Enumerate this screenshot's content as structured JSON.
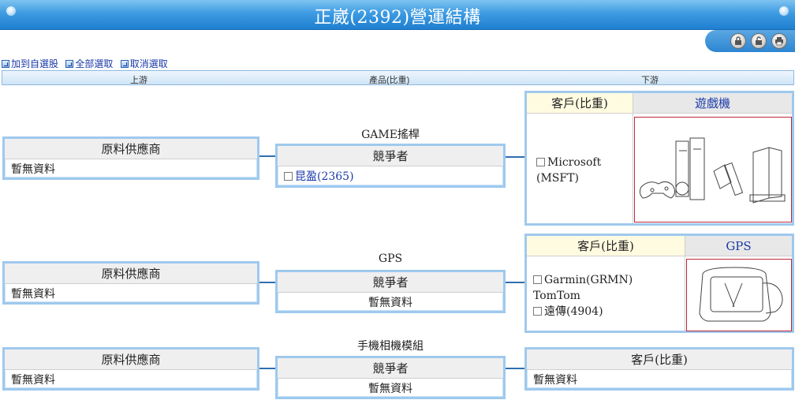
{
  "title": "正崴(2392)營運結構",
  "toolbar": {
    "icons": [
      "lock-icon",
      "unlock-icon",
      "print-icon"
    ]
  },
  "links": [
    "加到自選股",
    "全部選取",
    "取消選取"
  ],
  "columns": {
    "upstream": "上游",
    "product": "產品(比重)",
    "downstream": "下游"
  },
  "rows": [
    {
      "product_name": "GAME搖桿",
      "supplier_header": "原料供應商",
      "supplier_value": "暫無資料",
      "competitor_header": "競爭者",
      "competitors": [
        "昆盈(2365)"
      ],
      "customer_header": "客戶(比重)",
      "product_header": "遊戲機",
      "customers": [
        "Microsoft (MSFT)"
      ]
    },
    {
      "product_name": "GPS",
      "supplier_header": "原料供應商",
      "supplier_value": "暫無資料",
      "competitor_header": "競爭者",
      "competitor_value": "暫無資料",
      "customer_header": "客戶(比重)",
      "product_header": "GPS",
      "customers": [
        "Garmin(GRMN)",
        "TomTom",
        "遠傳(4904)"
      ]
    },
    {
      "product_name": "手機相機模組",
      "supplier_header": "原料供應商",
      "supplier_value": "暫無資料",
      "competitor_header": "競爭者",
      "competitor_value": "暫無資料",
      "customer_header": "客戶(比重)",
      "customer_value": "暫無資料"
    }
  ]
}
